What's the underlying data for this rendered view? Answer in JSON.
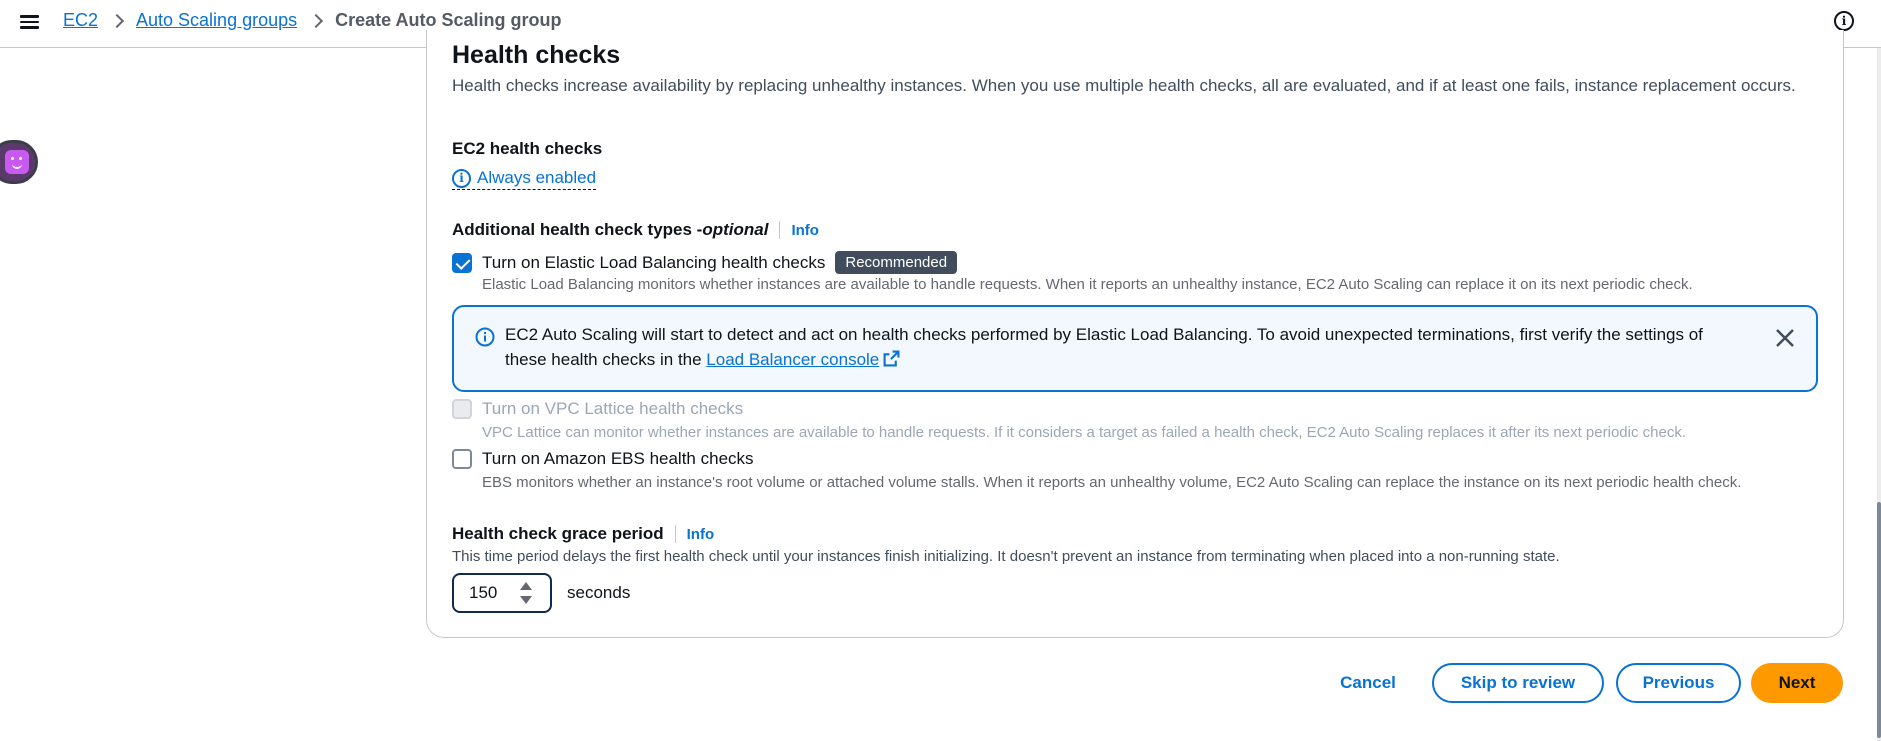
{
  "nav": {
    "breadcrumbs": [
      {
        "label": "EC2"
      },
      {
        "label": "Auto Scaling groups"
      },
      {
        "label": "Create Auto Scaling group"
      }
    ]
  },
  "section": {
    "title": "Health checks",
    "description": "Health checks increase availability by replacing unhealthy instances. When you use multiple health checks, all are evaluated, and if at least one fails, instance replacement occurs."
  },
  "ec2_health": {
    "title": "EC2 health checks",
    "status": "Always enabled"
  },
  "additional": {
    "title": "Additional health check types - ",
    "optional": "optional",
    "info": "Info",
    "options": [
      {
        "label": "Turn on Elastic Load Balancing health checks",
        "badge": "Recommended",
        "checked": true,
        "disabled": false,
        "description": "Elastic Load Balancing monitors whether instances are available to handle requests. When it reports an unhealthy instance, EC2 Auto Scaling can replace it on its next periodic check."
      },
      {
        "label": "Turn on VPC Lattice health checks",
        "checked": false,
        "disabled": true,
        "description": "VPC Lattice can monitor whether instances are available to handle requests. If it considers a target as failed a health check, EC2 Auto Scaling replaces it after its next periodic check."
      },
      {
        "label": "Turn on Amazon EBS health checks",
        "checked": false,
        "disabled": false,
        "description": "EBS monitors whether an instance's root volume or attached volume stalls. When it reports an unhealthy volume, EC2 Auto Scaling can replace the instance on its next periodic health check."
      }
    ]
  },
  "alert": {
    "text": "EC2 Auto Scaling will start to detect and act on health checks performed by Elastic Load Balancing. To avoid unexpected terminations, first verify the settings of these health checks in the ",
    "link": "Load Balancer console"
  },
  "grace": {
    "title": "Health check grace period",
    "info": "Info",
    "description": "This time period delays the first health check until your instances finish initializing. It doesn't prevent an instance from terminating when placed into a non-running state.",
    "value": "150",
    "units": "seconds"
  },
  "actions": {
    "cancel": "Cancel",
    "skip": "Skip to review",
    "previous": "Previous",
    "next": "Next"
  },
  "colors": {
    "link": "#0972d3",
    "primary_button": "#ff9900",
    "alert_bg": "#f2f8fd",
    "badge_bg": "#414d5c"
  }
}
